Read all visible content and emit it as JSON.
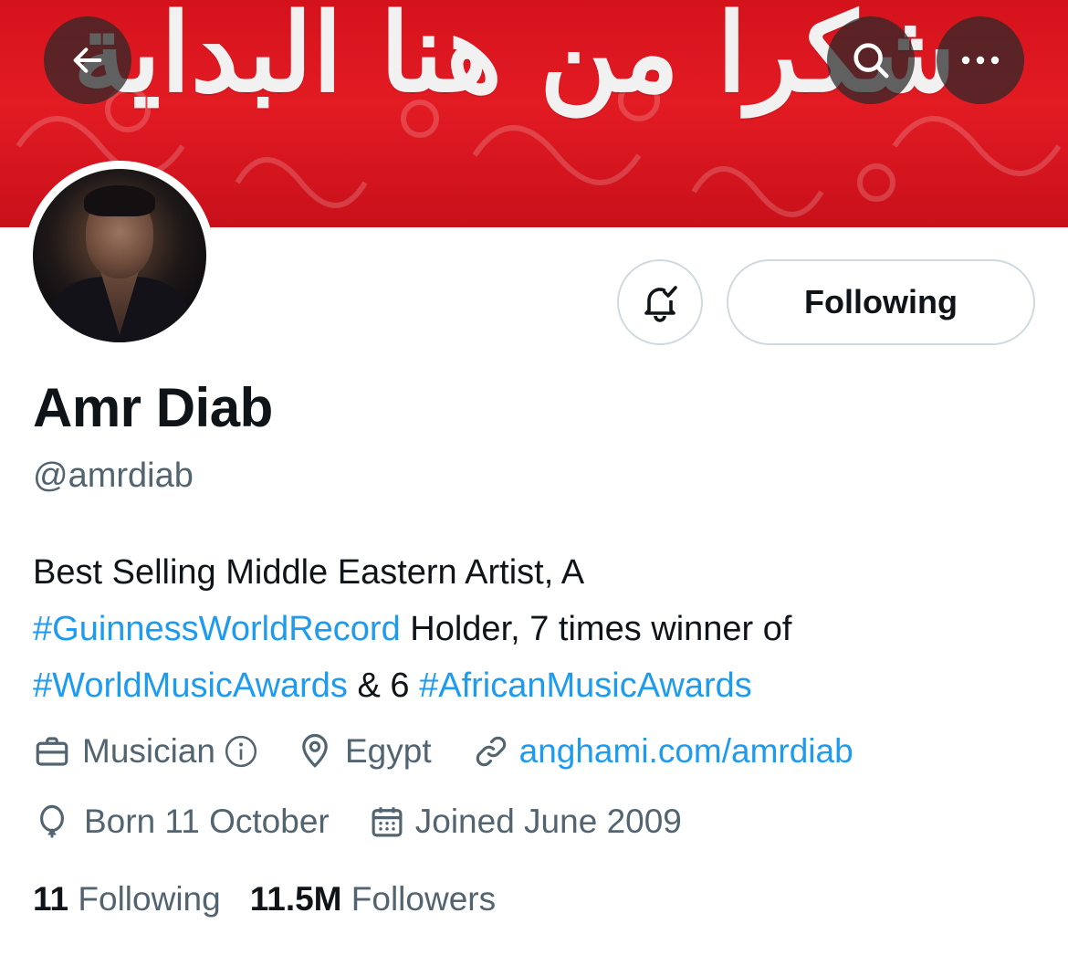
{
  "banner": {
    "script_text": "شكرا من هنا البداية",
    "color": "#e31b23"
  },
  "nav": {
    "back_icon": "arrow-left-icon",
    "search_icon": "search-icon",
    "more_icon": "more-dots-icon"
  },
  "profile": {
    "name": "Amr Diab",
    "handle": "@amrdiab",
    "bio": {
      "line1": "Best Selling Middle Eastern Artist, A",
      "tag1": "#GuinnessWorldRecord",
      "text2": " Holder, 7 times winner of",
      "tag2": "#WorldMusicAwards",
      "text3": " & 6 ",
      "tag3": "#AfricanMusicAwards"
    },
    "category": "Musician",
    "location": "Egypt",
    "website": "anghami.com/amrdiab",
    "birthday": "Born 11 October",
    "joined": "Joined June 2009"
  },
  "actions": {
    "following_label": "Following",
    "bell_icon": "bell-check-icon"
  },
  "stats": {
    "following_count": "11",
    "following_label": " Following",
    "followers_count": "11.5M",
    "followers_label": " Followers"
  },
  "colors": {
    "accent": "#1d9bf0",
    "text_primary": "#0f1419",
    "text_secondary": "#536471",
    "border": "#cfd9de"
  }
}
